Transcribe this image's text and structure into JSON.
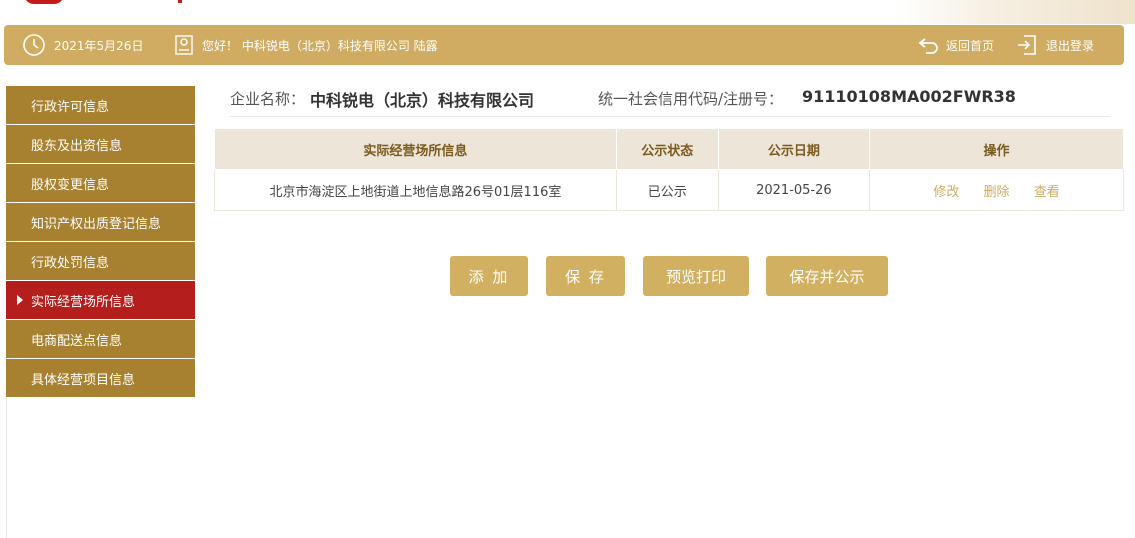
{
  "header": {
    "date": "2021年5月26日",
    "greeting": "您好！ 中科锐电（北京）科技有限公司  陆露",
    "back_home": "返回首页",
    "logout": "退出登录"
  },
  "sidebar": {
    "items": [
      {
        "label": "行政许可信息"
      },
      {
        "label": "股东及出资信息"
      },
      {
        "label": "股权变更信息"
      },
      {
        "label": "知识产权出质登记信息"
      },
      {
        "label": "行政处罚信息"
      },
      {
        "label": "实际经营场所信息"
      },
      {
        "label": "电商配送点信息"
      },
      {
        "label": "具体经营项目信息"
      }
    ],
    "active_index": 5
  },
  "company": {
    "name_label": "企业名称：",
    "name": "中科锐电（北京）科技有限公司",
    "code_label": "统一社会信用代码/注册号：",
    "code": "91110108MA002FWR38"
  },
  "table": {
    "headers": [
      "实际经营场所信息",
      "公示状态",
      "公示日期",
      "操作"
    ],
    "rows": [
      {
        "address": "北京市海淀区上地街道上地信息路26号01层116室",
        "status": "已公示",
        "date": "2021-05-26",
        "ops": [
          "修改",
          "删除",
          "查看"
        ]
      }
    ]
  },
  "buttons": {
    "add": "添 加",
    "save": "保 存",
    "preview_print": "预览打印",
    "save_publish": "保存并公示"
  },
  "colors": {
    "header_bg": "#cfac62",
    "sidebar_bg": "#a7812f",
    "sidebar_active": "#b41f1e",
    "button_bg": "#d1b062",
    "op_link": "#cdaa62"
  }
}
